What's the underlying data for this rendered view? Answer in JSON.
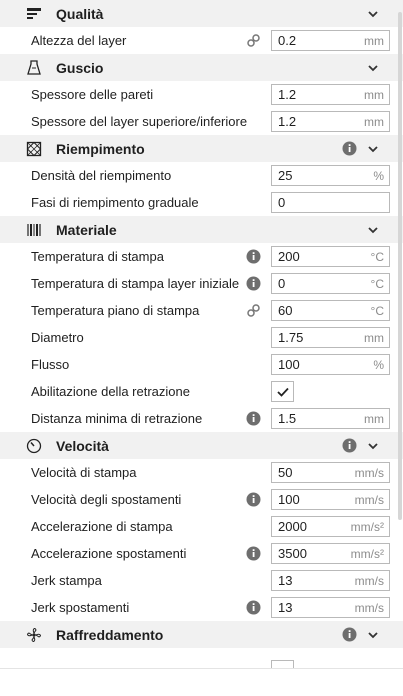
{
  "sections": {
    "quality": {
      "title": "Qualità",
      "icon": "quality-bars-icon"
    },
    "shell": {
      "title": "Guscio",
      "icon": "shell-icon"
    },
    "infill": {
      "title": "Riempimento",
      "icon": "infill-icon"
    },
    "material": {
      "title": "Materiale",
      "icon": "material-icon"
    },
    "speed": {
      "title": "Velocità",
      "icon": "speed-icon"
    },
    "cooling": {
      "title": "Raffreddamento",
      "icon": "fan-icon"
    }
  },
  "settings": {
    "layer_height": {
      "label": "Altezza del layer",
      "value": "0.2",
      "unit": "mm"
    },
    "wall_thickness": {
      "label": "Spessore delle pareti",
      "value": "1.2",
      "unit": "mm"
    },
    "top_bottom_thickness": {
      "label": "Spessore del layer superiore/inferiore",
      "value": "1.2",
      "unit": "mm"
    },
    "infill_density": {
      "label": "Densità del riempimento",
      "value": "25",
      "unit": "%"
    },
    "gradual_infill": {
      "label": "Fasi di riempimento graduale",
      "value": "0",
      "unit": ""
    },
    "print_temp": {
      "label": "Temperatura di stampa",
      "value": "200",
      "unit": "°C"
    },
    "initial_layer_temp": {
      "label": "Temperatura di stampa layer iniziale",
      "value": "0",
      "unit": "°C"
    },
    "bed_temp": {
      "label": "Temperatura piano di stampa",
      "value": "60",
      "unit": "°C"
    },
    "diameter": {
      "label": "Diametro",
      "value": "1.75",
      "unit": "mm"
    },
    "flow": {
      "label": "Flusso",
      "value": "100",
      "unit": "%"
    },
    "retraction_enable": {
      "label": "Abilitazione della retrazione",
      "checked": true
    },
    "retraction_min_distance": {
      "label": "Distanza minima di retrazione",
      "value": "1.5",
      "unit": "mm"
    },
    "print_speed": {
      "label": "Velocità di stampa",
      "value": "50",
      "unit": "mm/s"
    },
    "travel_speed": {
      "label": "Velocità degli spostamenti",
      "value": "100",
      "unit": "mm/s"
    },
    "print_accel": {
      "label": "Accelerazione di stampa",
      "value": "2000",
      "unit": "mm/s²"
    },
    "travel_accel": {
      "label": "Accelerazione spostamenti",
      "value": "3500",
      "unit": "mm/s²"
    },
    "print_jerk": {
      "label": "Jerk stampa",
      "value": "13",
      "unit": "mm/s"
    },
    "travel_jerk": {
      "label": "Jerk spostamenti",
      "value": "13",
      "unit": "mm/s"
    }
  },
  "colors": {
    "header_bg": "#f1f1f1",
    "field_border": "#b9b9b9",
    "unit_text": "#8c8c8c",
    "icon_gray": "#6e6e6e"
  }
}
